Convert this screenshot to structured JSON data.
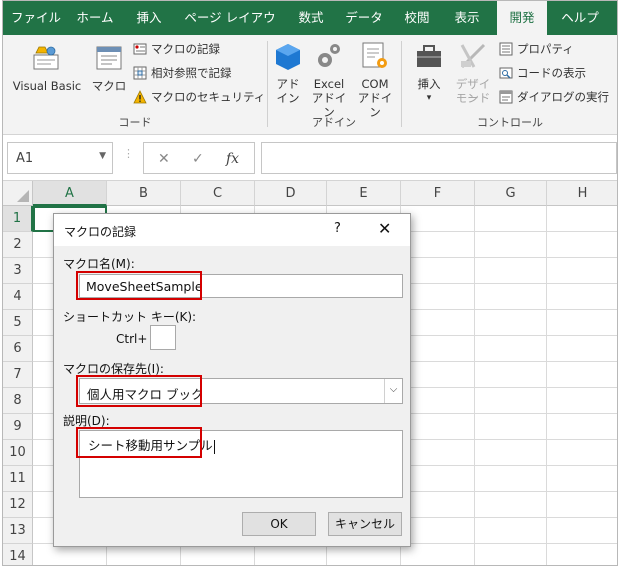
{
  "tabs": [
    "ファイル",
    "ホーム",
    "挿入",
    "ページ レイアウト",
    "数式",
    "データ",
    "校閲",
    "表示",
    "開発",
    "ヘルプ"
  ],
  "active_tab": "開発",
  "ribbon": {
    "code": {
      "visual_basic": "Visual Basic",
      "macro": "マクロ",
      "record_macro": "マクロの記録",
      "relative_ref": "相対参照で記録",
      "macro_security": "マクロのセキュリティ",
      "group_label": "コード"
    },
    "addins": {
      "addin_1": "アド",
      "addin_2": "イン",
      "excel_1": "Excel",
      "excel_2": "アドイン",
      "com_1": "COM",
      "com_2": "アドイン",
      "group_label": "アドイン"
    },
    "controls": {
      "insert": "挿入",
      "insert_arrow": "▾",
      "design_1": "デザイン",
      "design_2": "モード",
      "properties": "プロパティ",
      "view_code": "コードの表示",
      "run_dialog": "ダイアログの実行",
      "group_label": "コントロール"
    }
  },
  "formula_bar": {
    "name_box": "A1",
    "cancel_glyph": "✕",
    "enter_glyph": "✓",
    "fx_glyph": "fx"
  },
  "columns": [
    "A",
    "B",
    "C",
    "D",
    "E",
    "F",
    "G",
    "H"
  ],
  "rows": [
    "1",
    "2",
    "3",
    "4",
    "5",
    "6",
    "7",
    "8",
    "9",
    "10",
    "11",
    "12",
    "13",
    "14"
  ],
  "dialog": {
    "title": "マクロの記録",
    "help_glyph": "?",
    "close_glyph": "✕",
    "macro_name_label": "マクロ名(M):",
    "macro_name_value": "MoveSheetSample",
    "shortcut_label": "ショートカット キー(K):",
    "ctrl_label": "Ctrl+",
    "store_label": "マクロの保存先(I):",
    "store_value": "個人用マクロ ブック",
    "store_arrow": "⌵",
    "desc_label": "説明(D):",
    "desc_value": "シート移動用サンプル",
    "ok": "OK",
    "cancel": "キャンセル"
  },
  "colors": {
    "ribbon_green": "#217346",
    "highlight_red": "#d40000"
  }
}
